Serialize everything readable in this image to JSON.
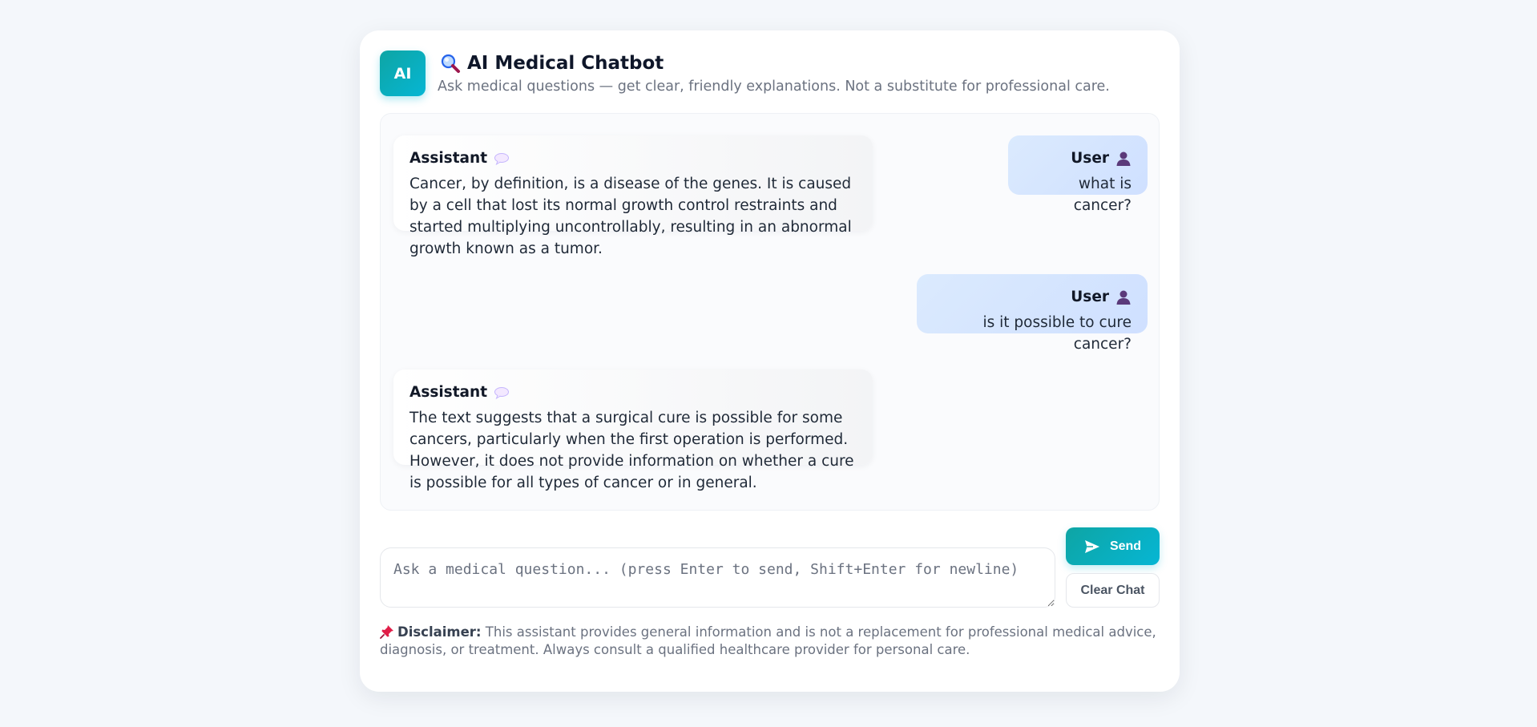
{
  "header": {
    "logo_text": "AI",
    "title": "AI Medical Chatbot",
    "title_icon": "magnifier-icon",
    "subtitle": "Ask medical questions — get clear, friendly explanations. Not a substitute for professional care."
  },
  "messages": [
    {
      "role": "Assistant",
      "icon": "speech-bubble-icon",
      "text": "Cancer, by definition, is a disease of the genes. It is caused by a cell that lost its normal growth control restraints and started multiplying uncontrollably, resulting in an abnormal growth known as a tumor."
    },
    {
      "role": "User",
      "icon": "user-silhouette-icon",
      "text": "what is cancer?"
    },
    {
      "role": "User",
      "icon": "user-silhouette-icon",
      "text": "is it possible to cure cancer?"
    },
    {
      "role": "Assistant",
      "icon": "speech-bubble-icon",
      "text": "The text suggests that a surgical cure is possible for some cancers, particularly when the first operation is performed. However, it does not provide information on whether a cure is possible for all types of cancer or in general."
    }
  ],
  "composer": {
    "placeholder": "Ask a medical question... (press Enter to send, Shift+Enter for newline)",
    "value": "",
    "send_label": "Send",
    "clear_label": "Clear Chat"
  },
  "disclaimer": {
    "label": "Disclaimer:",
    "text": "This assistant provides general information and is not a replacement for professional medical advice, diagnosis, or treatment. Always consult a qualified healthcare provider for personal care."
  },
  "colors": {
    "accent": "#06b6d4",
    "user_bubble": "#dbeafe",
    "background": "#f4f7fb"
  }
}
